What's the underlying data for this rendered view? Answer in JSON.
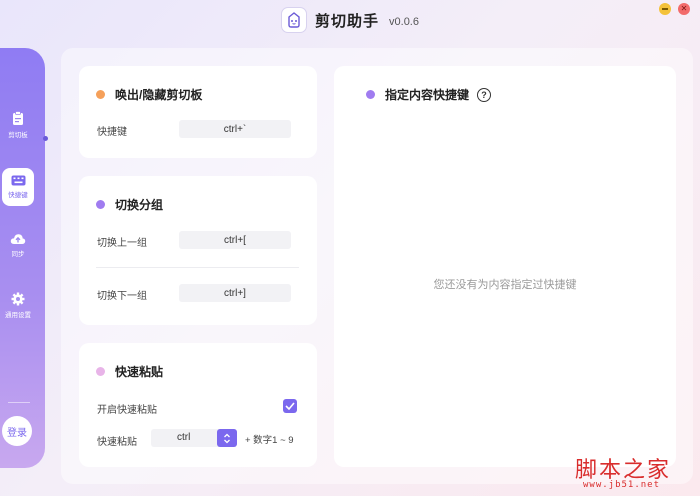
{
  "app": {
    "title": "剪切助手",
    "version": "v0.0.6"
  },
  "sidebar": {
    "items": [
      {
        "label": "剪切板",
        "icon": "clipboard-icon"
      },
      {
        "label": "快捷键",
        "icon": "keyboard-icon",
        "active": true
      },
      {
        "label": "同步",
        "icon": "cloud-upload-icon"
      },
      {
        "label": "通用设置",
        "icon": "gear-icon"
      }
    ],
    "login": "登录"
  },
  "toggle_card": {
    "title": "唤出/隐藏剪切板",
    "dot_color": "#f5a05a",
    "shortcut_label": "快捷键",
    "shortcut_value": "ctrl+`"
  },
  "switch_card": {
    "title": "切换分组",
    "dot_color": "#a07cf0",
    "prev_label": "切换上一组",
    "prev_value": "ctrl+[",
    "next_label": "切换下一组",
    "next_value": "ctrl+]"
  },
  "paste_card": {
    "title": "快速粘贴",
    "dot_color": "#e8b4e8",
    "enable_label": "开启快速粘贴",
    "enable_checked": true,
    "paste_label": "快速粘贴",
    "modifier_value": "ctrl",
    "suffix": "+ 数字1 ~ 9"
  },
  "content_card": {
    "title": "指定内容快捷键",
    "dot_color": "#a07cf0",
    "empty_text": "您还没有为内容指定过快捷键"
  },
  "watermark": {
    "text": "脚本之家",
    "url": "www.jb51.net"
  },
  "colors": {
    "accent": "#7b68ee"
  }
}
